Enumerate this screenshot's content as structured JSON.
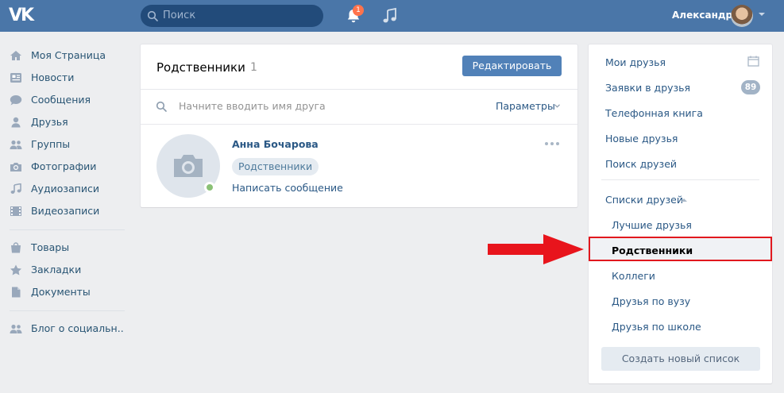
{
  "header": {
    "logo": "VK",
    "search_placeholder": "Поиск",
    "notification_count": "1",
    "user_name": "Александр",
    "icons": [
      "vk-logo",
      "search-icon",
      "bell-icon",
      "music-icon",
      "avatar",
      "chevron-down-icon"
    ]
  },
  "nav": {
    "items": [
      {
        "label": "Моя Страница",
        "icon": "home-icon"
      },
      {
        "label": "Новости",
        "icon": "news-icon"
      },
      {
        "label": "Сообщения",
        "icon": "messages-icon"
      },
      {
        "label": "Друзья",
        "icon": "user-icon"
      },
      {
        "label": "Группы",
        "icon": "groups-icon"
      },
      {
        "label": "Фотографии",
        "icon": "camera-icon"
      },
      {
        "label": "Аудиозаписи",
        "icon": "music-icon"
      },
      {
        "label": "Видеозаписи",
        "icon": "film-icon"
      }
    ],
    "items2": [
      {
        "label": "Товары",
        "icon": "bag-icon"
      },
      {
        "label": "Закладки",
        "icon": "star-icon"
      },
      {
        "label": "Документы",
        "icon": "document-icon"
      }
    ],
    "items3": [
      {
        "label": "Блог о социальн..",
        "icon": "groups-icon"
      }
    ]
  },
  "main": {
    "title": "Родственники",
    "count": "1",
    "edit_label": "Редактировать",
    "search_placeholder": "Начните вводить имя друга",
    "params_label": "Параметры",
    "friend": {
      "name": "Анна Бочарова",
      "tag": "Родственники",
      "message_link": "Написать сообщение"
    }
  },
  "side": {
    "items": [
      {
        "label": "Мои друзья"
      },
      {
        "label": "Заявки в друзья",
        "badge": "89"
      },
      {
        "label": "Телефонная книга"
      },
      {
        "label": "Новые друзья"
      },
      {
        "label": "Поиск друзей"
      }
    ],
    "lists_label": "Списки друзей",
    "lists": [
      {
        "label": "Лучшие друзья"
      },
      {
        "label": "Родственники",
        "selected": true
      },
      {
        "label": "Коллеги"
      },
      {
        "label": "Друзья по вузу"
      },
      {
        "label": "Друзья по школе"
      }
    ],
    "create_label": "Создать новый список"
  },
  "colors": {
    "header": "#4a76a8",
    "link": "#2a5885",
    "button": "#5181b8",
    "highlight": "#e1181e",
    "online": "#8ac176"
  }
}
